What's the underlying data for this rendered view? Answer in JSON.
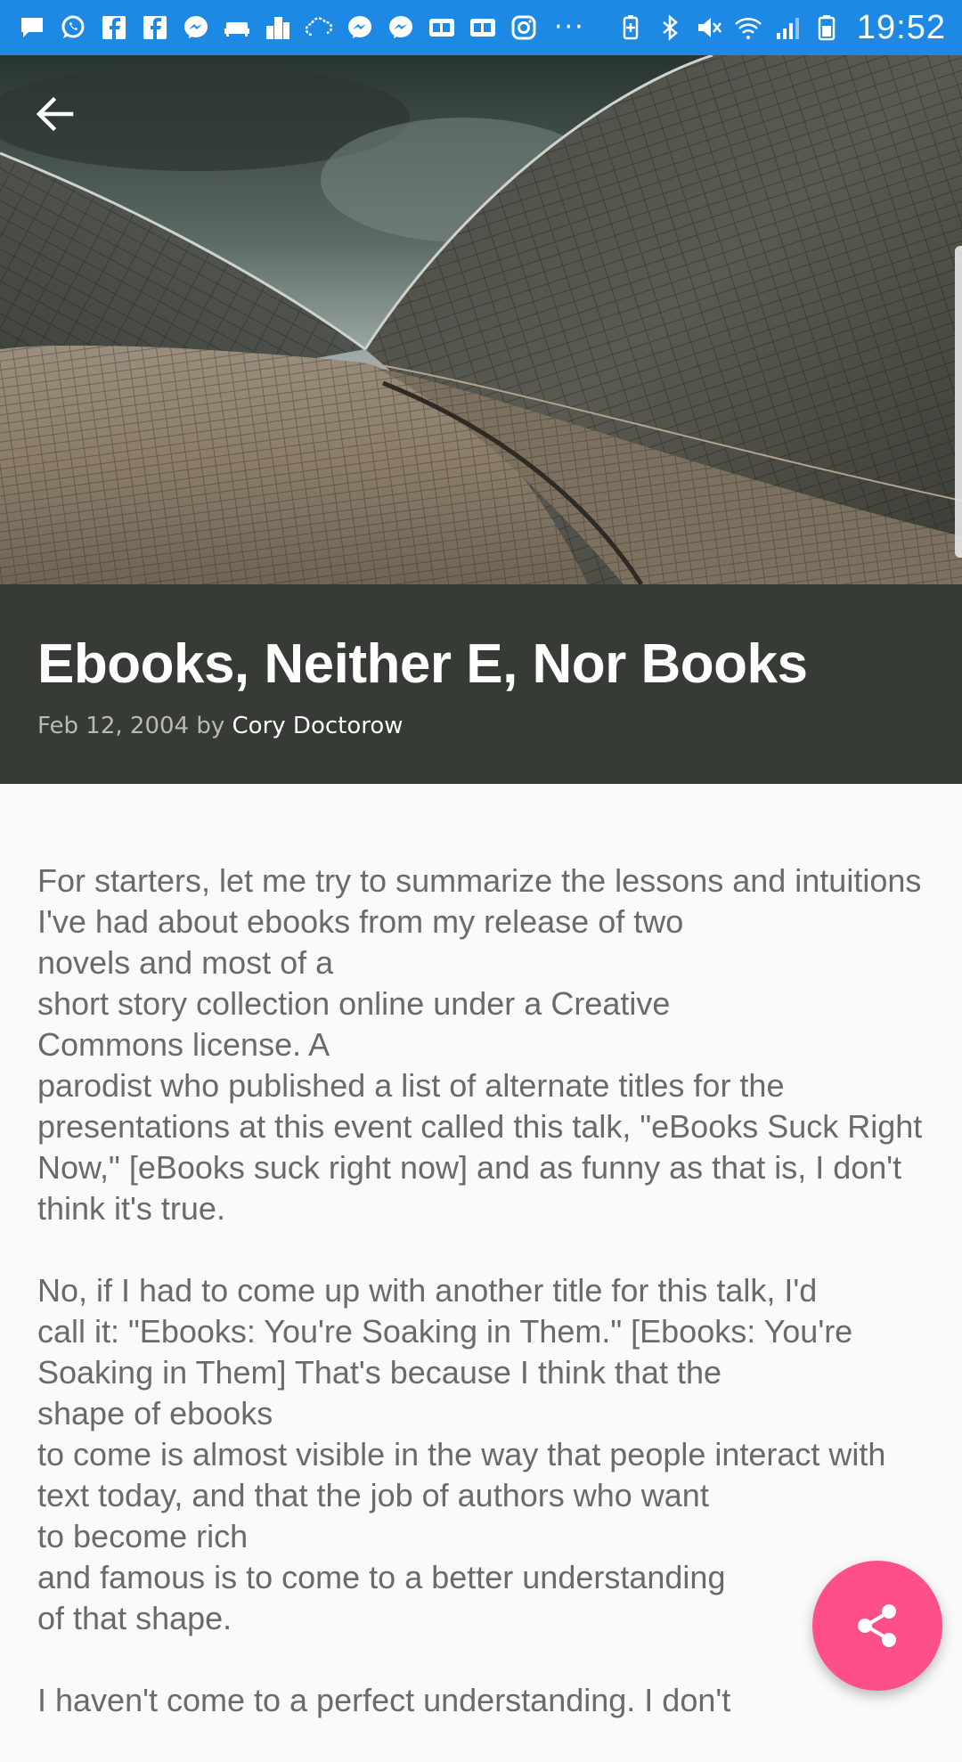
{
  "status_bar": {
    "time": "19:52",
    "notification_icons": [
      "message-icon",
      "whatsapp-icon",
      "facebook-icon",
      "facebook-icon",
      "messenger-icon",
      "sofa-icon",
      "buildings-icon",
      "cloud-icon",
      "messenger-icon",
      "messenger-icon",
      "gb-icon",
      "gb-icon",
      "instagram-icon"
    ],
    "more": "···",
    "system_icons": [
      "battery-saver-icon",
      "bluetooth-icon",
      "mute-icon",
      "wifi-icon",
      "signal-icon",
      "battery-icon"
    ]
  },
  "header": {
    "back_icon": "arrow-back-icon"
  },
  "post": {
    "title": "Ebooks, Neither E, Nor Books",
    "date": "Feb 12, 2004",
    "by": "by",
    "author": "Cory Doctorow"
  },
  "body": {
    "paragraphs": [
      [
        "For starters, let me try to summarize the lessons and intuitions",
        "I've had about ebooks from my release of two",
        "novels and most of a",
        "short story collection online under a Creative",
        "Commons license. A",
        "parodist who published a list of alternate titles for the",
        "presentations at this event called this talk, \"eBooks Suck Right",
        "Now,\" [eBooks suck right now] and as funny as that is, I don't",
        "think it's true."
      ],
      [
        "No, if I had to come up with another title for this talk, I'd",
        "call it: \"Ebooks: You're Soaking in Them.\" [Ebooks: You're",
        "Soaking in Them] That's because I think that the",
        "shape of ebooks",
        "to come is almost visible in the way that people interact with",
        "text today, and that the job of authors who want",
        "to become rich",
        "and famous is to come to a better understanding",
        "of that shape."
      ],
      [
        "I haven't come to a perfect understanding. I don't"
      ]
    ]
  },
  "fab": {
    "icon": "share-icon",
    "color": "#ff4f8b"
  },
  "colors": {
    "status_bar": "#1e88e5",
    "title_block": "#373b36",
    "background": "#fafafa"
  }
}
